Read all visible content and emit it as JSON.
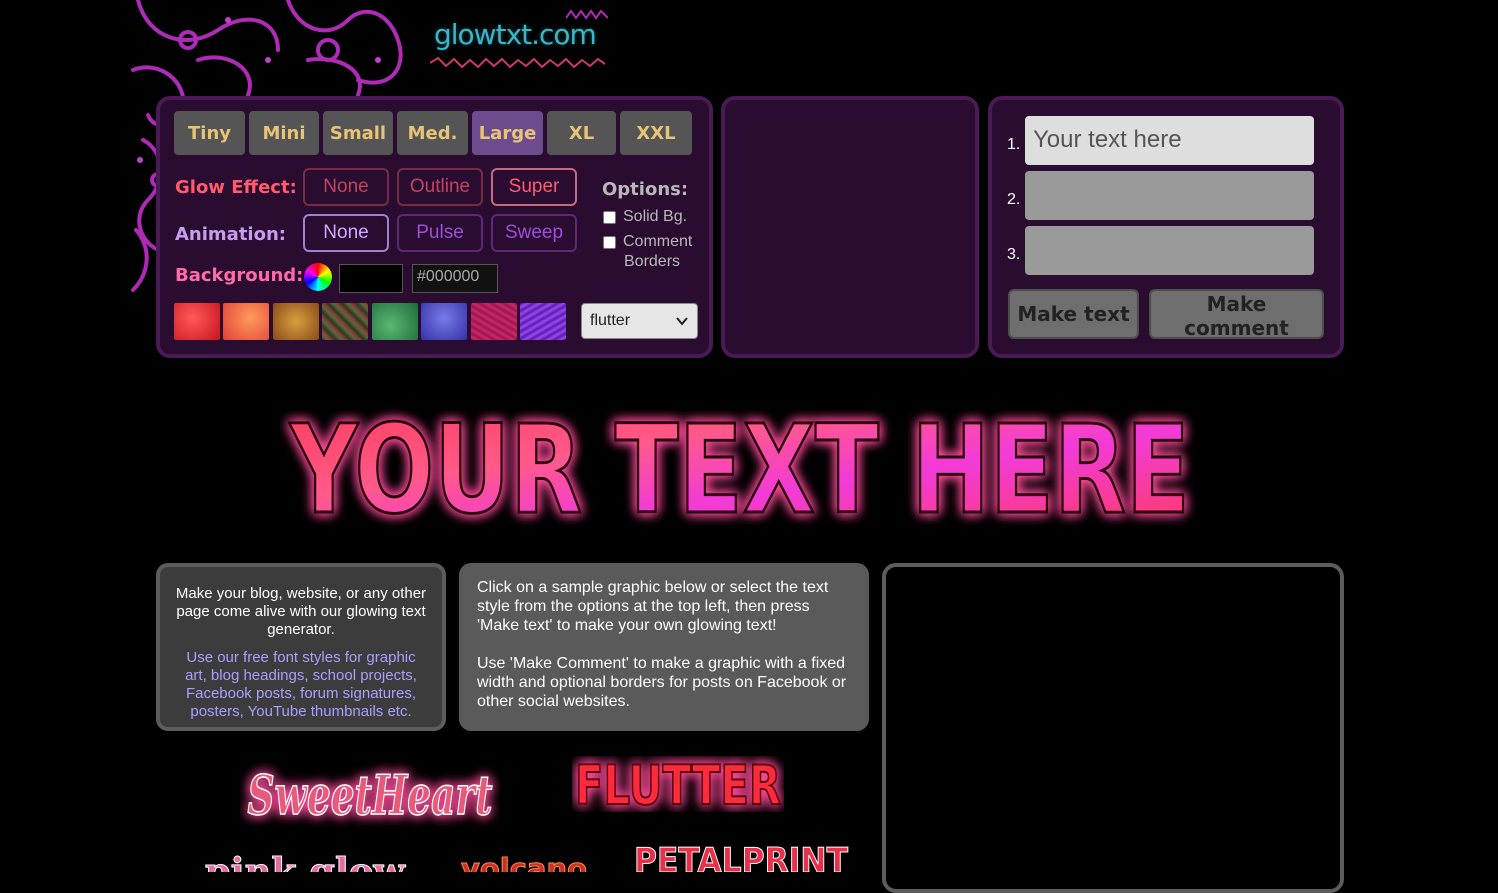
{
  "site": {
    "logo": "glowtxt.com"
  },
  "sizes": [
    {
      "label": "Tiny",
      "active": false
    },
    {
      "label": "Mini",
      "active": false
    },
    {
      "label": "Small",
      "active": false
    },
    {
      "label": "Med.",
      "active": false
    },
    {
      "label": "Large",
      "active": true
    },
    {
      "label": "XL",
      "active": false
    },
    {
      "label": "XXL",
      "active": false
    }
  ],
  "glow_effect": {
    "label": "Glow Effect:",
    "options": [
      "None",
      "Outline",
      "Super"
    ],
    "selected": "Super"
  },
  "animation": {
    "label": "Animation:",
    "options": [
      "None",
      "Pulse",
      "Sweep"
    ],
    "selected": "None"
  },
  "background": {
    "label": "Background:",
    "color": "#000000",
    "hex": "#000000",
    "swatch_colors": [
      "#e3262e",
      "#f06a45",
      "#b88a2a",
      "#4a5a3a",
      "#2e8a4e",
      "#5252c8",
      "#b01a5a",
      "#7a2ac8"
    ]
  },
  "options": {
    "title": "Options:",
    "items": [
      {
        "label": "Solid Bg.",
        "checked": false
      },
      {
        "label_line1": "Comment",
        "label_line2": "Borders",
        "checked": false
      }
    ]
  },
  "font_select": {
    "value": "flutter"
  },
  "text_lines": [
    {
      "num": "1.",
      "value": "Your text here"
    },
    {
      "num": "2.",
      "value": ""
    },
    {
      "num": "3.",
      "value": ""
    }
  ],
  "buttons": {
    "make_text": "Make text",
    "make_comment": "Make comment"
  },
  "preview": {
    "text": "YOUR TEXT HERE"
  },
  "info_left": {
    "intro": "Make your blog, website, or any other page come alive with our glowing text generator.",
    "more": "Use our free font styles for graphic art, blog headings, school projects, Facebook posts, forum signatures, posters, YouTube thumbnails etc."
  },
  "info_mid": {
    "p1": "Click on a sample graphic below or select the text style from the options at the top left, then press 'Make text' to make your own glowing text!",
    "p2": "Use 'Make Comment' to make a graphic with a fixed width and optional borders for posts on Facebook or other social websites."
  },
  "samples": {
    "sweetheart": "SweetHeart",
    "flutter": "FLUTTER",
    "petalprint": "PETALPRINT",
    "volcano": "volcano",
    "pinkglow": "pink glow"
  },
  "colors": {
    "panel_bg": "#2a0c30",
    "panel_border": "#4a1a55",
    "glow_label": "#ff5a6e",
    "anim_label": "#c89cf0",
    "accent_text": "#e8c478"
  }
}
